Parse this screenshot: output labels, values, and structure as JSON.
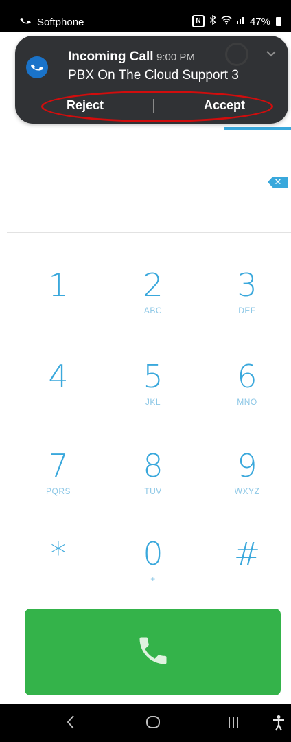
{
  "status_bar": {
    "app_name": "Softphone",
    "nfc_label": "N",
    "battery_percent": "47%"
  },
  "notification": {
    "title": "Incoming Call",
    "time": "9:00 PM",
    "body": "PBX On The Cloud Support 3",
    "reject_label": "Reject",
    "accept_label": "Accept"
  },
  "dial_display": {
    "delete_label": "✕"
  },
  "keypad": {
    "k1": {
      "digit": "1",
      "letters": ""
    },
    "k2": {
      "digit": "2",
      "letters": "ABC"
    },
    "k3": {
      "digit": "3",
      "letters": "DEF"
    },
    "k4": {
      "digit": "4",
      "letters": ""
    },
    "k5": {
      "digit": "5",
      "letters": "JKL"
    },
    "k6": {
      "digit": "6",
      "letters": "MNO"
    },
    "k7": {
      "digit": "7",
      "letters": "PQRS"
    },
    "k8": {
      "digit": "8",
      "letters": "TUV"
    },
    "k9": {
      "digit": "9",
      "letters": "WXYZ"
    },
    "kstar": {
      "digit": "*",
      "letters": ""
    },
    "k0": {
      "digit": "0",
      "letters": "+"
    },
    "khash": {
      "digit": "#",
      "letters": ""
    }
  },
  "icons": {
    "status_app": "phone-handset-icon",
    "call": "phone-icon",
    "nav_back": "back-icon",
    "nav_home": "home-icon",
    "nav_recents": "recents-icon",
    "nav_accessibility": "accessibility-icon"
  },
  "colors": {
    "accent": "#3aa8dc",
    "call_green": "#34b34a",
    "annotation_red": "#d10d0d",
    "notification_bg": "#28292d"
  }
}
